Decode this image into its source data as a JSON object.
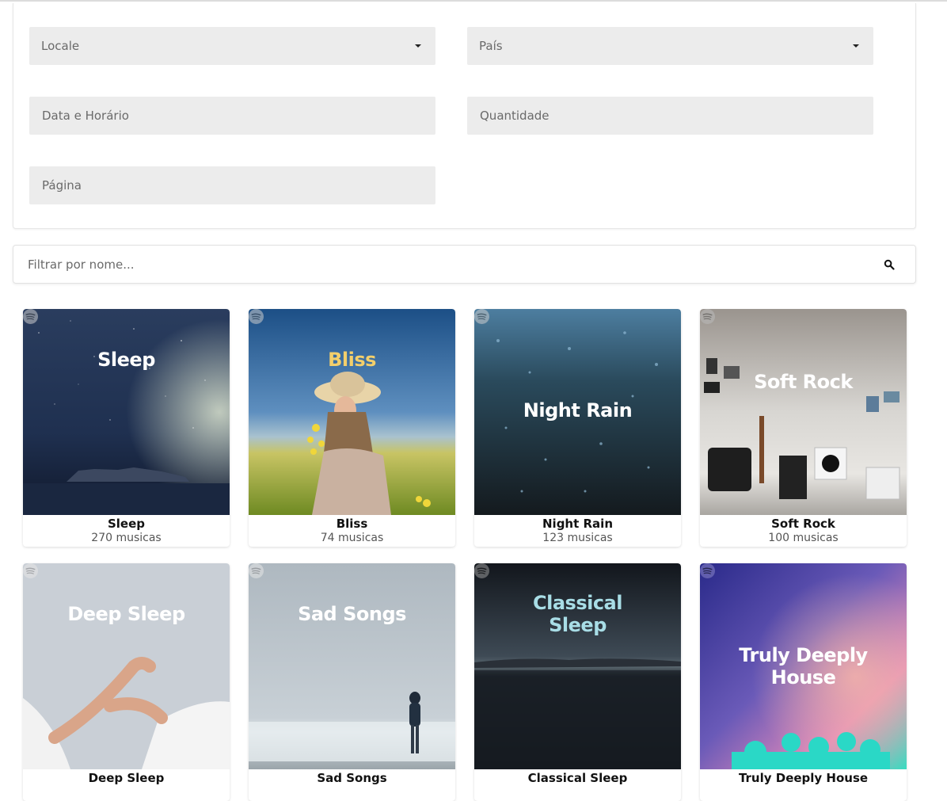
{
  "filters": {
    "locale_label": "Locale",
    "country_label": "País",
    "datetime_placeholder": "Data e Horário",
    "quantity_placeholder": "Quantidade",
    "page_placeholder": "Página"
  },
  "search": {
    "placeholder": "Filtrar por nome..."
  },
  "playlists": [
    {
      "cover_title": "Sleep",
      "name": "Sleep",
      "count": "270 musicas"
    },
    {
      "cover_title": "Bliss",
      "name": "Bliss",
      "count": "74 musicas"
    },
    {
      "cover_title": "Night Rain",
      "name": "Night Rain",
      "count": "123 musicas"
    },
    {
      "cover_title": "Soft Rock",
      "name": "Soft Rock",
      "count": "100 musicas"
    },
    {
      "cover_title": "Deep Sleep",
      "name": "Deep Sleep",
      "count": ""
    },
    {
      "cover_title": "Sad Songs",
      "name": "Sad Songs",
      "count": ""
    },
    {
      "cover_title": "Classical\nSleep",
      "name": "Classical Sleep",
      "count": ""
    },
    {
      "cover_title": "Truly Deeply\nHouse",
      "name": "Truly Deeply House",
      "count": ""
    }
  ],
  "icons": {
    "search": "search-icon",
    "dropdown": "caret-down-icon",
    "brand": "spotify-icon"
  }
}
